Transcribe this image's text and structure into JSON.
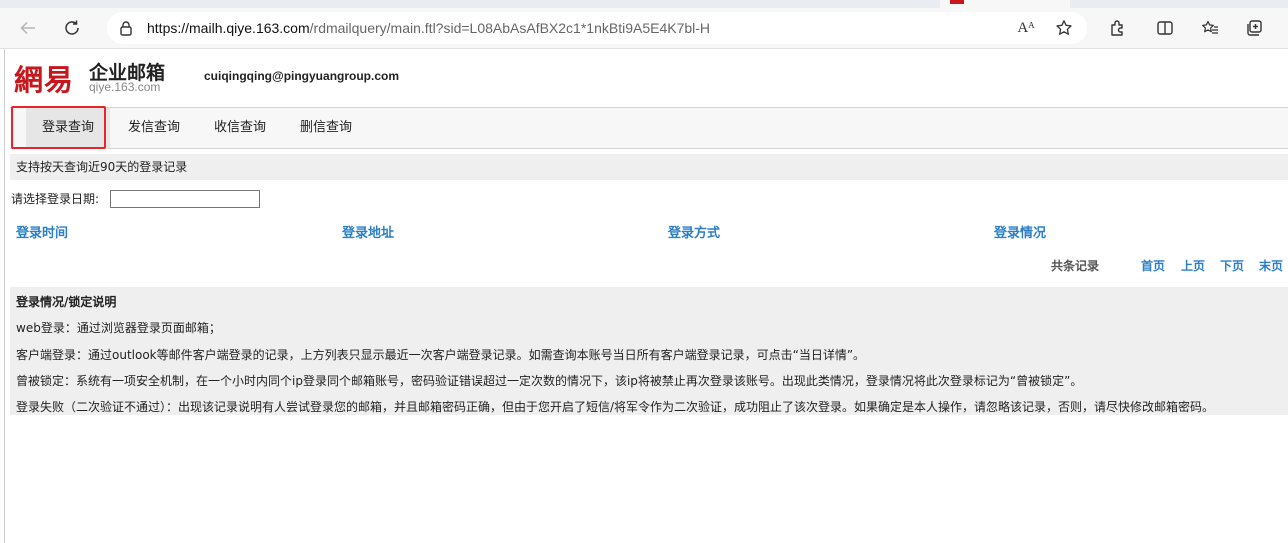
{
  "browser": {
    "url_host": "https://mailh.qiye.163.com",
    "url_path": "/rdmailquery/main.ftl?sid=L08AbAsAfBX2c1*1nkBti9A5E4K7bl-H",
    "read_aloud_glyph": "Aᴬ"
  },
  "header": {
    "logo_text": "網易",
    "product_name": "企业邮箱",
    "domain": "qiye.163.com",
    "user_email": "cuiqingqing@pingyuangroup.com"
  },
  "nav": {
    "tabs": [
      {
        "label": "登录查询",
        "active": true
      },
      {
        "label": "发信查询",
        "active": false
      },
      {
        "label": "收信查询",
        "active": false
      },
      {
        "label": "删信查询",
        "active": false
      }
    ]
  },
  "main": {
    "notice": "支持按天查询近90天的登录记录",
    "date_label": "请选择登录日期:",
    "date_value": "",
    "columns": [
      "登录时间",
      "登录地址",
      "登录方式",
      "登录情况"
    ],
    "pager": {
      "total": "共条记录",
      "first": "首页",
      "prev": "上页",
      "next": "下页",
      "last": "末页"
    }
  },
  "help": {
    "title": "登录情况/锁定说明",
    "lines": [
      "web登录：通过浏览器登录页面邮箱；",
      "客户端登录：通过outlook等邮件客户端登录的记录，上方列表只显示最近一次客户端登录记录。如需查询本账号当日所有客户端登录记录，可点击“当日详情”。",
      "曾被锁定：系统有一项安全机制，在一个小时内同个ip登录同个邮箱账号，密码验证错误超过一定次数的情况下，该ip将被禁止再次登录该账号。出现此类情况，登录情况将此次登录标记为“曾被锁定”。",
      "登录失败（二次验证不通过）：出现该记录说明有人尝试登录您的邮箱，并且邮箱密码正确，但由于您开启了短信/将军令作为二次验证，成功阻止了该次登录。如果确定是本人操作，请忽略该记录，否则，请尽快修改邮箱密码。"
    ]
  },
  "colors": {
    "link": "#2b7fc6",
    "logo_red": "#c8161d",
    "highlight": "#e8232a"
  }
}
